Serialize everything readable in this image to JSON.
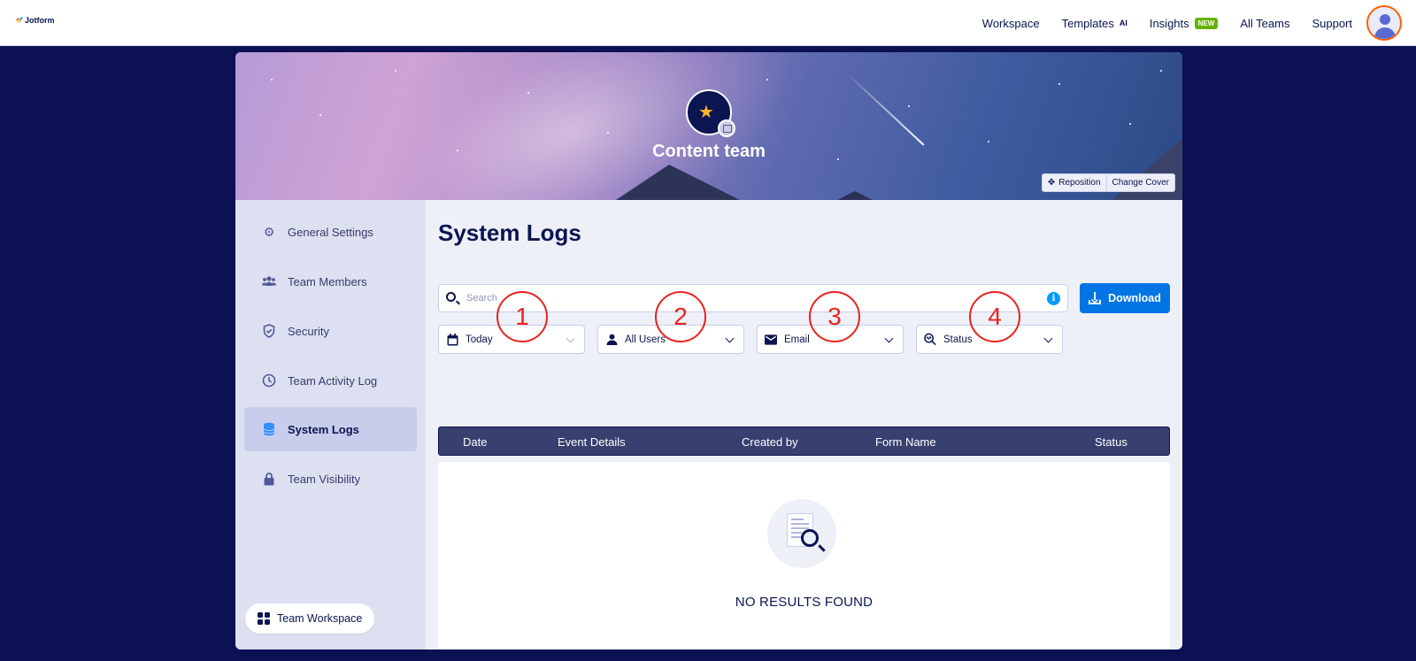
{
  "nav": {
    "logo_text": "Jotform",
    "workspace": "Workspace",
    "templates": "Templates",
    "templates_badge": "AI",
    "insights": "Insights",
    "insights_badge": "NEW",
    "all_teams": "All Teams",
    "support": "Support"
  },
  "cover": {
    "team_name": "Content team",
    "reposition_label": "Reposition",
    "change_cover_label": "Change Cover"
  },
  "sidebar": {
    "items": [
      {
        "label": "General Settings",
        "icon": "gear-icon"
      },
      {
        "label": "Team Members",
        "icon": "users-icon"
      },
      {
        "label": "Security",
        "icon": "shield-icon"
      },
      {
        "label": "Team Activity Log",
        "icon": "clock-icon"
      },
      {
        "label": "System Logs",
        "icon": "database-icon",
        "active": true
      },
      {
        "label": "Team Visibility",
        "icon": "lock-icon"
      }
    ],
    "workspace_button": "Team Workspace"
  },
  "main": {
    "title": "System Logs",
    "search_placeholder": "Search",
    "download_label": "Download",
    "filters": {
      "date": "Today",
      "users": "All Users",
      "type": "Email",
      "status": "Status"
    },
    "columns": [
      "Date",
      "Event Details",
      "Created by",
      "Form Name",
      "Status"
    ],
    "empty_message": "NO RESULTS FOUND"
  },
  "annotations": [
    "1",
    "2",
    "3",
    "4"
  ],
  "colors": {
    "page_bg": "#0c1153",
    "accent": "#0075e3",
    "sidebar_bg": "#dde0f1",
    "table_header": "#37406f",
    "annotation": "#e8231c"
  }
}
